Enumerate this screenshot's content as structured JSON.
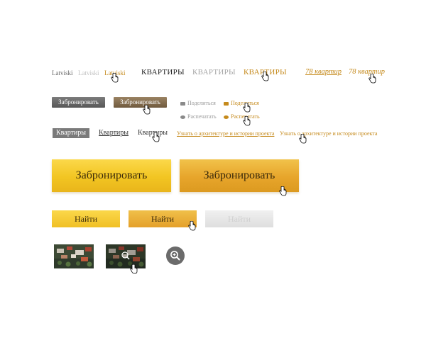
{
  "languages": [
    "Latviski",
    "Latviski",
    "Latviski"
  ],
  "nav": {
    "items": [
      "КВАРТИРЫ",
      "КВАРТИРЫ",
      "КВАРТИРЫ"
    ],
    "italic_items": [
      "78 квартир",
      "78 квартир"
    ]
  },
  "reserve_small": [
    "Забронировать",
    "Забронировать"
  ],
  "share": {
    "share_label": "Поделиться",
    "print_label": "Распечатать"
  },
  "tabs": [
    "Квартиры",
    "Квартиры",
    "Квартиры"
  ],
  "learn_more": [
    "Узнать о архитектуре и истории проекта",
    "Узнать о архитектуре и истории проекта"
  ],
  "reserve_big": [
    "Забронировать",
    "Забронировать"
  ],
  "find": [
    "Найти",
    "Найти",
    "Найти"
  ],
  "icons": {
    "cursor": "hand-cursor-icon",
    "zoom": "zoom-in-icon"
  },
  "colors": {
    "accent_gold": "#c58a1c",
    "button_yellow": "#f2c522",
    "button_orange": "#e7a52b",
    "button_gray": "#666666"
  }
}
